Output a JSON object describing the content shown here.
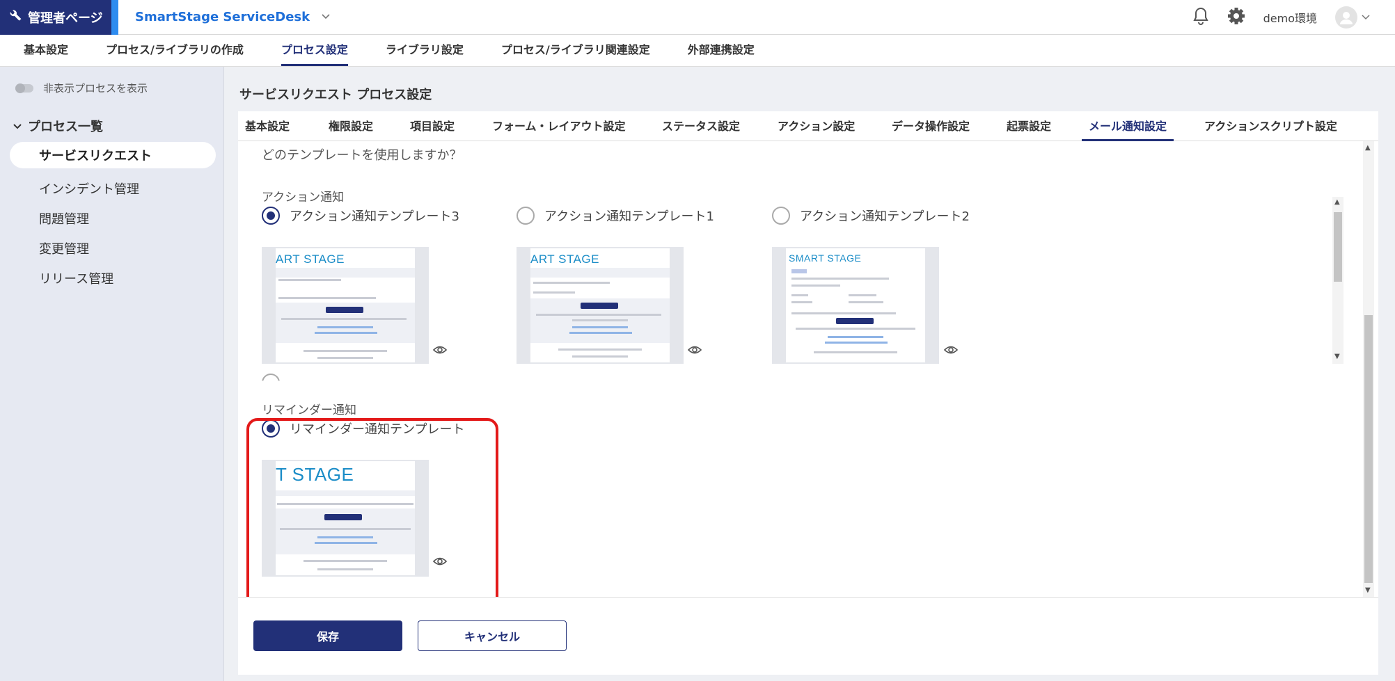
{
  "header": {
    "admin_label": "管理者ページ",
    "product_name": "SmartStage ServiceDesk",
    "env_label": "demo環境"
  },
  "main_nav": [
    "基本設定",
    "プロセス/ライブラリの作成",
    "プロセス設定",
    "ライブラリ設定",
    "プロセス/ライブラリ関連設定",
    "外部連携設定"
  ],
  "main_nav_active": "プロセス設定",
  "sidebar": {
    "toggle_label": "非表示プロセスを表示",
    "section_title": "プロセス一覧",
    "items": [
      "サービスリクエスト",
      "インシデント管理",
      "問題管理",
      "変更管理",
      "リリース管理"
    ],
    "active": "サービスリクエスト"
  },
  "content": {
    "title": "サービスリクエスト プロセス設定",
    "tabs": [
      "基本設定",
      "権限設定",
      "項目設定",
      "フォーム・レイアウト設定",
      "ステータス設定",
      "アクション設定",
      "データ操作設定",
      "起票設定",
      "メール通知設定",
      "アクションスクリプト設定"
    ],
    "active_tab": "メール通知設定",
    "question": "どのテンプレートを使用しますか？",
    "action_group": {
      "label": "アクション通知",
      "options": [
        {
          "label": "アクション通知テンプレート3",
          "checked": true,
          "logo": "ART STAGE"
        },
        {
          "label": "アクション通知テンプレート1",
          "checked": false,
          "logo": "ART STAGE"
        },
        {
          "label": "アクション通知テンプレート2",
          "checked": false,
          "logo": "SMART STAGE"
        }
      ]
    },
    "reminder_group": {
      "label": "リマインダー通知",
      "options": [
        {
          "label": "リマインダー通知テンプレート",
          "checked": true,
          "logo": "T STAGE"
        }
      ]
    },
    "save_label": "保存",
    "cancel_label": "キャンセル"
  },
  "colors": {
    "brand": "#223078",
    "accent": "#2d8cf0",
    "highlight": "#e31919"
  }
}
